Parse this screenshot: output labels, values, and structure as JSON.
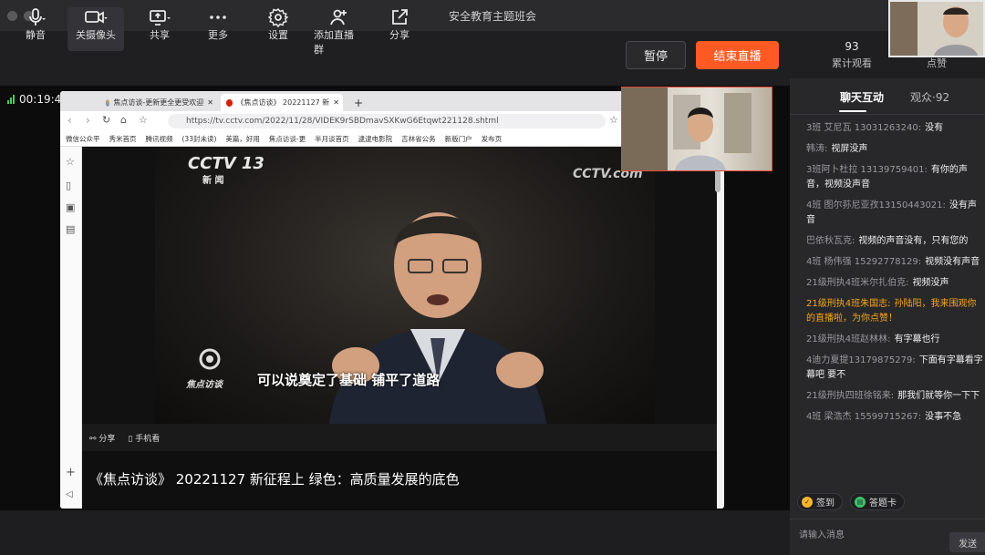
{
  "window": {
    "title": "安全教育主题班会"
  },
  "toolbar": {
    "mute": {
      "label": "静音",
      "icon": "microphone-icon"
    },
    "camera": {
      "label": "关摄像头",
      "icon": "camera-icon"
    },
    "share": {
      "label": "共享",
      "icon": "screen-share-icon"
    },
    "more": {
      "label": "更多",
      "icon": "more-icon"
    },
    "settings": {
      "label": "设置",
      "icon": "gear-icon"
    },
    "add_group": {
      "label": "添加直播群",
      "icon": "add-group-icon"
    },
    "share_out": {
      "label": "分享",
      "icon": "share-icon"
    },
    "pause_label": "暂停",
    "end_label": "结束直播",
    "viewers_count": "93",
    "viewers_label": "累计观看",
    "likes_label": "点赞"
  },
  "stage": {
    "timer": "00:19:46"
  },
  "browser": {
    "tabs": [
      "焦点访谈-更新更全更受欢迎",
      "《焦点访谈》 20221127 新"
    ],
    "new_tab": "+",
    "url": "https://tv.cctv.com/2022/11/28/VIDEK9rSBDmavSXKwG6Etqwt221128.shtml",
    "bookmarks": [
      "微信公众平",
      "秀米首页",
      "腾讯视频",
      "(33封未读)",
      "美篇，好用",
      "焦点访谈-更",
      "半月谈首页",
      "逮逮电影院",
      "吉林省公务",
      "新版门户",
      "发布页"
    ],
    "video": {
      "channel_logo": "CCTV 13",
      "channel_sub": "新  闻",
      "watermark": "CCTV.com",
      "program_logo": "焦点访谈",
      "subtitle": "可以说奠定了基础 铺平了道路"
    },
    "actions": {
      "share": "分享",
      "mobile": "手机看"
    },
    "video_title": "《焦点访谈》 20221127 新征程上 绿色：高质量发展的底色"
  },
  "panel": {
    "tab_chat": "聊天互动",
    "tab_audience": "观众·92",
    "messages": [
      {
        "name": "3班 艾尼瓦 13031263240:",
        "text": "没有",
        "highlight": false
      },
      {
        "name": "韩涛:",
        "text": "视屏没声",
        "highlight": false
      },
      {
        "name": "3班阿卜杜拉 13139759401:",
        "text": "有你的声音，视频没声音",
        "highlight": false
      },
      {
        "name": "4班 图尔荪尼亚孜13150443021:",
        "text": "没有声音",
        "highlight": false
      },
      {
        "name": "巴依秋瓦克:",
        "text": "视频的声音没有，只有您的",
        "highlight": false
      },
      {
        "name": "4班 杨伟强 15292778129:",
        "text": "视频没有声音",
        "highlight": false
      },
      {
        "name": "21级刑执4班米尔扎伯克:",
        "text": "视频没声",
        "highlight": false
      },
      {
        "name": "21级刑执4班朱国志:",
        "text": "孙陆阳，我来围观你的直播啦，为你点赞！",
        "highlight": true
      },
      {
        "name": "21级刑执4班赵林林:",
        "text": "有字幕也行",
        "highlight": false
      },
      {
        "name": "4迪力夏提13179875279:",
        "text": "下面有字幕看字幕吧 要不",
        "highlight": false
      },
      {
        "name": "21级刑执四班徐铭来:",
        "text": "那我们就等你一下下",
        "highlight": false
      },
      {
        "name": "4班 梁浩杰 15599715267:",
        "text": "没事不急",
        "highlight": false
      }
    ],
    "checkin_label": "签到",
    "answer_card_label": "答题卡",
    "input_placeholder": "请输入消息",
    "send_label": "发送"
  }
}
